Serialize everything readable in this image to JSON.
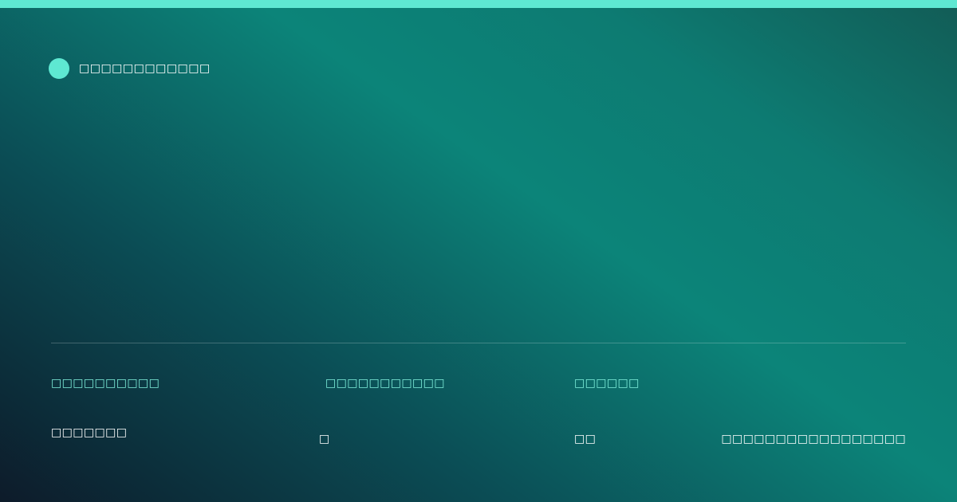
{
  "accent_color": "#5ee8d2",
  "brand": {
    "text": "□□□□□□□□□□□□",
    "logo_icon": "circle-logo-icon"
  },
  "meta": {
    "col1": {
      "label": "□□□□□□□□□□",
      "value": "□□□□□□□"
    },
    "col2": {
      "label": "□□□□□□□□□□□",
      "value": "□"
    },
    "col3": {
      "label": "□□□□□□",
      "value": "□□"
    },
    "col4": {
      "value": "□□□□□□□□□□□□□□□□□"
    }
  }
}
